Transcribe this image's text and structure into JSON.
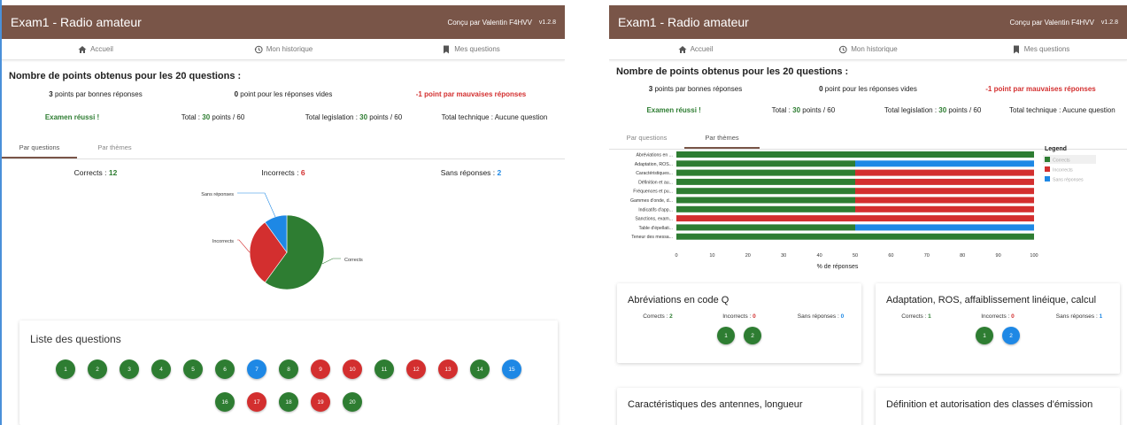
{
  "app": {
    "title": "Exam1 - Radio amateur",
    "credit": "Conçu par Valentin F4HVV",
    "version": "v1.2.8"
  },
  "nav": {
    "home": "Accueil",
    "history": "Mon historique",
    "questions": "Mes questions"
  },
  "summary": {
    "heading": "Nombre de points obtenus pour les 20 questions :",
    "good_num": "3",
    "good_text": " points par bonnes réponses",
    "empty_num": "0",
    "empty_text": " point pour les réponses vides",
    "bad_text": "-1 point par mauvaises réponses",
    "result": "Examen réussi !",
    "total_label": "Total : ",
    "total_value": "30",
    "total_suffix": " points / 60",
    "law_label": "Total legislation : ",
    "law_value": "30",
    "law_suffix": " points / 60",
    "tech_text": "Total technique : Aucune question"
  },
  "tabs": {
    "by_question": "Par questions",
    "by_theme": "Par thèmes"
  },
  "counts": {
    "correct_label": "Corrects : ",
    "correct_value": "12",
    "incorrect_label": "Incorrects : ",
    "incorrect_value": "6",
    "empty_label": "Sans réponses : ",
    "empty_value": "2"
  },
  "colors": {
    "correct": "#2e7d32",
    "incorrect": "#d32f2f",
    "empty": "#1e88e5",
    "appbar": "#795548"
  },
  "pie_chart": {
    "type": "pie",
    "labels": [
      "Corrects",
      "Incorrects",
      "Sans réponses"
    ],
    "values": [
      12,
      6,
      2
    ]
  },
  "question_list": {
    "title": "Liste des questions",
    "row1": [
      {
        "n": "1",
        "s": "correct"
      },
      {
        "n": "2",
        "s": "correct"
      },
      {
        "n": "3",
        "s": "correct"
      },
      {
        "n": "4",
        "s": "correct"
      },
      {
        "n": "5",
        "s": "correct"
      },
      {
        "n": "6",
        "s": "correct"
      },
      {
        "n": "7",
        "s": "empty"
      },
      {
        "n": "8",
        "s": "correct"
      },
      {
        "n": "9",
        "s": "wrong"
      },
      {
        "n": "10",
        "s": "wrong"
      },
      {
        "n": "11",
        "s": "correct"
      },
      {
        "n": "12",
        "s": "wrong"
      },
      {
        "n": "13",
        "s": "wrong"
      },
      {
        "n": "14",
        "s": "correct"
      },
      {
        "n": "15",
        "s": "empty"
      }
    ],
    "row2": [
      {
        "n": "16",
        "s": "correct"
      },
      {
        "n": "17",
        "s": "wrong"
      },
      {
        "n": "18",
        "s": "correct"
      },
      {
        "n": "19",
        "s": "wrong"
      },
      {
        "n": "20",
        "s": "correct"
      }
    ]
  },
  "chart_data": {
    "type": "bar",
    "orientation": "horizontal",
    "stacked": true,
    "categories": [
      "Abréviations en ...",
      "Adaptation, ROS...",
      "Caractéristiques...",
      "Définition et au...",
      "Fréquences et pu...",
      "Gammes d'onde, d...",
      "Indicatifs d'app...",
      "Sanctions, exam...",
      "Table d'épellati...",
      "Teneur des messa..."
    ],
    "series": [
      {
        "name": "Corrects",
        "values": [
          100,
          50,
          50,
          50,
          50,
          50,
          50,
          0,
          50,
          100
        ]
      },
      {
        "name": "Incorrects",
        "values": [
          0,
          0,
          50,
          50,
          50,
          50,
          50,
          100,
          0,
          0
        ]
      },
      {
        "name": "Sans réponses",
        "values": [
          0,
          50,
          0,
          0,
          0,
          0,
          0,
          0,
          50,
          0
        ]
      }
    ],
    "xlabel": "% de réponses",
    "xticks": [
      "0",
      "10",
      "20",
      "30",
      "40",
      "50",
      "60",
      "70",
      "80",
      "90",
      "100"
    ],
    "xlim": [
      0,
      100
    ],
    "legend_title": "Legend",
    "legend_position": "right"
  },
  "theme_cards": [
    {
      "title": "Abréviations en code Q",
      "correct": "2",
      "incorrect": "0",
      "empty": "0",
      "questions": [
        {
          "n": "1",
          "s": "correct"
        },
        {
          "n": "2",
          "s": "correct"
        }
      ]
    },
    {
      "title": "Adaptation, ROS, affaiblissement linéique, calcul",
      "correct": "1",
      "incorrect": "0",
      "empty": "1",
      "questions": [
        {
          "n": "1",
          "s": "correct"
        },
        {
          "n": "2",
          "s": "empty"
        }
      ]
    },
    {
      "title": "Caractéristiques des antennes, longueur"
    },
    {
      "title": "Définition et autorisation des classes d'émission"
    }
  ],
  "theme_count_labels": {
    "correct": "Corrects : ",
    "incorrect": "Incorrects : ",
    "empty": "Sans réponses : "
  }
}
